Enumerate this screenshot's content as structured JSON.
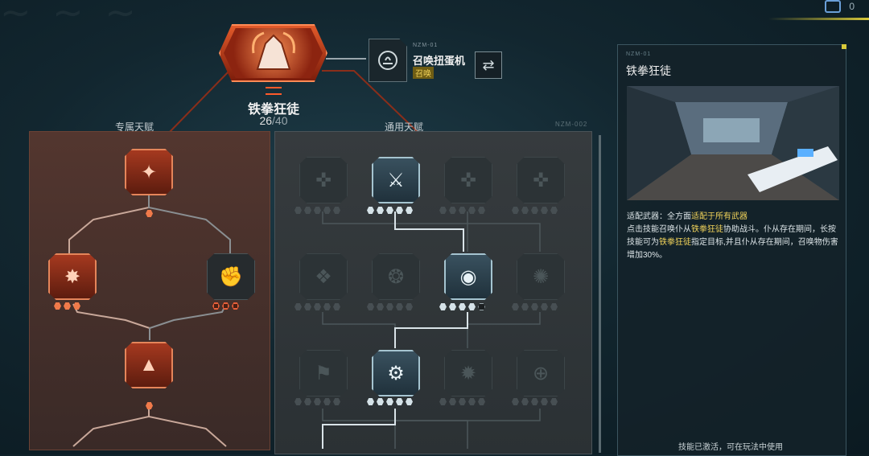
{
  "hero": {
    "name": "铁拳狂徒",
    "count": "26",
    "max": "/40"
  },
  "summon": {
    "code": "NZM-01",
    "name": "召唤扭蛋机",
    "tag": "召唤"
  },
  "sections": {
    "left": "专属天赋",
    "mid": "通用天赋",
    "code": "NZM-002"
  },
  "info": {
    "code": "NZM-01",
    "title": "铁拳狂徒",
    "weapon_label": "适配武器：全方面",
    "weapon_value": "适配于所有武器",
    "desc_1": "点击技能召唤仆从",
    "desc_hl_1": "铁拳狂徒",
    "desc_2": "协助战斗。仆从存在期间，长按技能可为",
    "desc_hl_2": "铁拳狂徒",
    "desc_3": "指定目标,并且仆从存在期间，召唤物伤害增加30%。",
    "footer": "技能已激活，可在玩法中使用"
  },
  "colors": {
    "accent_red": "#e4531f",
    "highlight_yellow": "#f1d35a",
    "panel_teal": "#142229"
  },
  "talents_exclusive": [
    {
      "id": "ex-top",
      "icon": "flame-claw-icon",
      "state": "red",
      "levels": [
        1,
        1
      ]
    },
    {
      "id": "ex-left",
      "icon": "spike-burst-icon",
      "state": "red",
      "levels": [
        3,
        3
      ]
    },
    {
      "id": "ex-right",
      "icon": "smash-fist-icon",
      "state": "dark",
      "levels": [
        0,
        3
      ]
    },
    {
      "id": "ex-bottom",
      "icon": "triangle-blade-icon",
      "state": "red",
      "levels": [
        1,
        1
      ]
    }
  ],
  "talents_general": [
    {
      "icon": "pistol-icon",
      "state": "dim",
      "levels": [
        0,
        5
      ]
    },
    {
      "icon": "rifle-icon",
      "state": "lit",
      "levels": [
        5,
        5
      ]
    },
    {
      "icon": "smg-icon",
      "state": "dim",
      "levels": [
        0,
        5
      ]
    },
    {
      "icon": "sniper-icon",
      "state": "dim",
      "levels": [
        0,
        5
      ]
    },
    {
      "icon": "crest-icon",
      "state": "dim",
      "levels": [
        0,
        5
      ]
    },
    {
      "icon": "beast-icon",
      "state": "dim",
      "levels": [
        0,
        5
      ]
    },
    {
      "icon": "eye-sigil-icon",
      "state": "lit",
      "levels": [
        4,
        5
      ]
    },
    {
      "icon": "wings-icon",
      "state": "dim",
      "levels": [
        0,
        5
      ]
    },
    {
      "icon": "banner-icon",
      "state": "dim",
      "levels": [
        0,
        5
      ]
    },
    {
      "icon": "summon-figure-icon",
      "state": "lit",
      "levels": [
        5,
        5
      ]
    },
    {
      "icon": "fire-icon",
      "state": "dim",
      "levels": [
        0,
        5
      ]
    },
    {
      "icon": "crosshair-icon",
      "state": "dim",
      "levels": [
        0,
        5
      ]
    }
  ]
}
